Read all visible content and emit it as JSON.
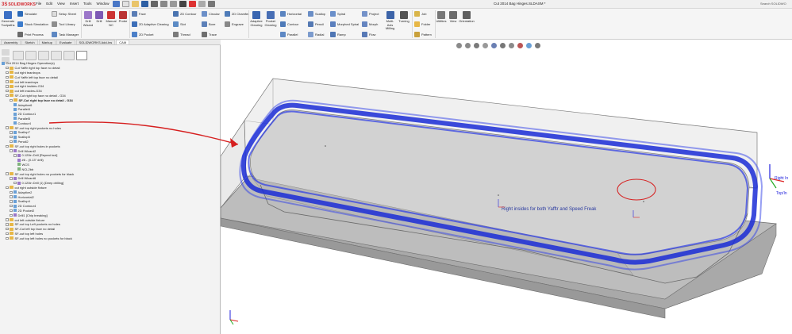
{
  "app": {
    "logo_ds": "3S",
    "logo_name": "SOLIDWORKS",
    "doc_title": "Cut 2014 Bag Hinges.SLDASM *",
    "search_placeholder": "Search SOLIDWO"
  },
  "menu": [
    "File",
    "Edit",
    "View",
    "Insert",
    "Tools",
    "Window"
  ],
  "ribbon": {
    "generate": "Generate Toolpaths",
    "simulate": "Simulate",
    "stock_sim": "Stock Simulation",
    "print_process": "Print Process",
    "setup_sheet": "Setup Sheet",
    "tool_library": "Tool Library",
    "task_manager": "Task Manager",
    "drill_wizard": "Drill Wizard",
    "hole_wizard": "Drill",
    "manual_nc": "Manual NC",
    "probe": "Probe",
    "face": "Face",
    "adaptive_2d": "2D Adaptive Clearing",
    "pocket_2d": "2D Pocket",
    "contour_2d": "2D Contour",
    "slot": "Slot",
    "thread": "Thread",
    "circular": "Circular",
    "bore": "Bore",
    "trace": "Trace",
    "chamfer_2d": "2D Chamfer",
    "engrave": "Engrave",
    "adaptive_clearing": "Adaptive Clearing",
    "pocket_clearing": "Pocket Clearing",
    "horizontal": "Horizontal",
    "contour": "Contour",
    "parallel": "Parallel",
    "scallop": "Scallop",
    "pencil": "Pencil",
    "radial": "Radial",
    "spiral": "Spiral",
    "morphed_spiral": "Morphed Spiral",
    "ramp": "Ramp",
    "project": "Project",
    "morph": "Morph",
    "flow": "Flow",
    "multi_axis": "Multi-Axis Milling",
    "turning": "Turning",
    "job": "Job",
    "folder": "Folder",
    "pattern": "Pattern",
    "utilities": "Utilities",
    "view": "View",
    "orientation": "Orientation"
  },
  "tabs": [
    "Assembly",
    "Sketch",
    "Markup",
    "Evaluate",
    "SOLIDWORKS Add-Ins",
    "CAM"
  ],
  "tree": [
    {
      "label": "Cut 2014 Bag Hinges Operation(s)",
      "indent": 0,
      "icon": "op",
      "exp": false
    },
    {
      "label": "Cut Yafftr right top face no detail",
      "indent": 1,
      "icon": "fold",
      "exp": true
    },
    {
      "label": "cut right teardrops",
      "indent": 1,
      "icon": "fold",
      "exp": true
    },
    {
      "label": "Cut Yafftr left top face no detail",
      "indent": 1,
      "icon": "fold",
      "exp": true
    },
    {
      "label": "cut left teardrops",
      "indent": 1,
      "icon": "fold",
      "exp": true
    },
    {
      "label": "cut right insides-G34",
      "indent": 1,
      "icon": "fold",
      "exp": true
    },
    {
      "label": "cut left insides-G34",
      "indent": 1,
      "icon": "fold",
      "exp": true
    },
    {
      "label": "SF-Cut right top face no detail - G34",
      "indent": 1,
      "icon": "fold",
      "exp": true
    },
    {
      "label": "SF-Cut right top face no detail - G34",
      "indent": 2,
      "icon": "fold",
      "exp": true,
      "bold": true
    },
    {
      "label": "Adaptive6",
      "indent": 3,
      "icon": "op",
      "exp": false
    },
    {
      "label": "Parallel4",
      "indent": 3,
      "icon": "op",
      "exp": false
    },
    {
      "label": "2D Contour1",
      "indent": 3,
      "icon": "op",
      "exp": false
    },
    {
      "label": "Parallel5",
      "indent": 3,
      "icon": "op",
      "exp": false
    },
    {
      "label": "Contour4",
      "indent": 3,
      "icon": "op",
      "exp": false
    },
    {
      "label": "SF-cut top right pockets no holes",
      "indent": 1,
      "icon": "fold",
      "exp": true
    },
    {
      "label": "Scallop7",
      "indent": 2,
      "icon": "op",
      "exp": true
    },
    {
      "label": "Scallop5",
      "indent": 2,
      "icon": "op",
      "exp": true
    },
    {
      "label": "Pencil2",
      "indent": 2,
      "icon": "op",
      "exp": true
    },
    {
      "label": "SF-cut top right holes in pockets",
      "indent": 1,
      "icon": "fold",
      "exp": true
    },
    {
      "label": "Drill Wizard2",
      "indent": 2,
      "icon": "dr",
      "exp": true
    },
    {
      "label": "0.120in Drill [Repeat tool]",
      "indent": 3,
      "icon": "dr",
      "exp": true
    },
    {
      "label": "#6 - (0.13\" drill)",
      "indent": 4,
      "icon": "dr",
      "exp": false
    },
    {
      "label": "WCS",
      "indent": 4,
      "icon": "ref",
      "exp": false
    },
    {
      "label": "NCL2bb",
      "indent": 4,
      "icon": "ref",
      "exp": false
    },
    {
      "label": "SF-cut top right holes no pockets for black",
      "indent": 1,
      "icon": "fold",
      "exp": true
    },
    {
      "label": "Drill Wizard6",
      "indent": 2,
      "icon": "dr",
      "exp": true
    },
    {
      "label": "0.120in Drill (1) [Deep drilling]",
      "indent": 3,
      "icon": "dr",
      "exp": true
    },
    {
      "label": "cut right outside fixture",
      "indent": 1,
      "icon": "fold",
      "exp": true
    },
    {
      "label": "Adaptive2",
      "indent": 2,
      "icon": "op",
      "exp": true
    },
    {
      "label": "Horizontal2",
      "indent": 2,
      "icon": "op",
      "exp": true
    },
    {
      "label": "Scallop4",
      "indent": 2,
      "icon": "op",
      "exp": true
    },
    {
      "label": "2D Contour4",
      "indent": 2,
      "icon": "op",
      "exp": true
    },
    {
      "label": "2D Pocket2",
      "indent": 2,
      "icon": "op",
      "exp": true
    },
    {
      "label": "Drill1 [Chip breaking]",
      "indent": 2,
      "icon": "dr",
      "exp": true
    },
    {
      "label": "cut left outside fixture",
      "indent": 1,
      "icon": "fold",
      "exp": true
    },
    {
      "label": "SF-cut top Left pockets no holes",
      "indent": 1,
      "icon": "fold",
      "exp": true
    },
    {
      "label": "SF-Cut left top face no detail",
      "indent": 1,
      "icon": "fold",
      "exp": true
    },
    {
      "label": "SF-cut top left holes",
      "indent": 1,
      "icon": "fold",
      "exp": true
    },
    {
      "label": "SF-cut top left holes no pockets for black",
      "indent": 1,
      "icon": "fold",
      "exp": true
    }
  ],
  "viewport": {
    "annotation": "Right insides for both Yafftr and Speed Freak",
    "triad_label_1": "Right In",
    "triad_label_2": "Top/In"
  },
  "colors": {
    "toolpath": "#1a2bd6",
    "arrow": "#d61f1f",
    "part": "#c8c8c8",
    "stock_edge": "#7a7a7a",
    "triad_x": "#d22",
    "triad_y": "#2a2",
    "triad_z": "#22d"
  }
}
